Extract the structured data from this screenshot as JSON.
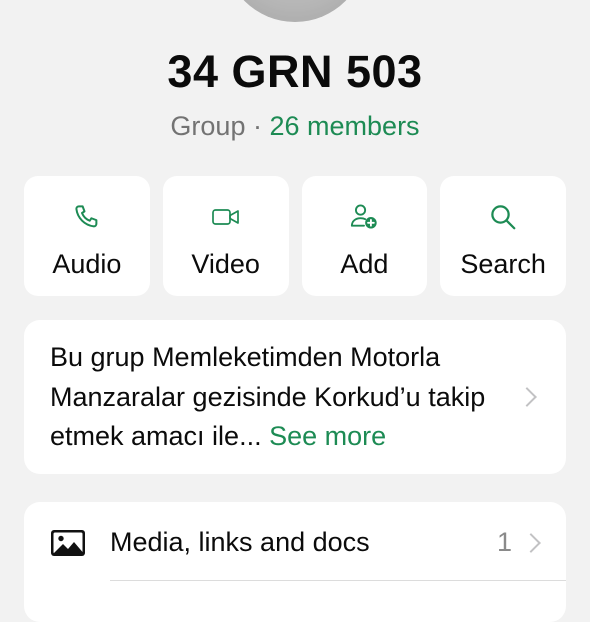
{
  "group": {
    "name": "34 GRN 503",
    "kind": "Group",
    "separator": "·",
    "members": "26 members"
  },
  "actions": [
    {
      "label": "Audio",
      "icon": "phone-icon"
    },
    {
      "label": "Video",
      "icon": "video-icon"
    },
    {
      "label": "Add",
      "icon": "add-member-icon"
    },
    {
      "label": "Search",
      "icon": "search-icon"
    }
  ],
  "description": {
    "text": "Bu grup Memleketimden Motorla Manzaralar gezisinde Korkud’u takip etmek amacı ile...",
    "see_more": "See more"
  },
  "media": {
    "label": "Media, links and docs",
    "count": "1"
  },
  "colors": {
    "accent": "#1d8b54",
    "background": "#f2f2f2",
    "card": "#ffffff",
    "secondary_text": "#737373"
  }
}
